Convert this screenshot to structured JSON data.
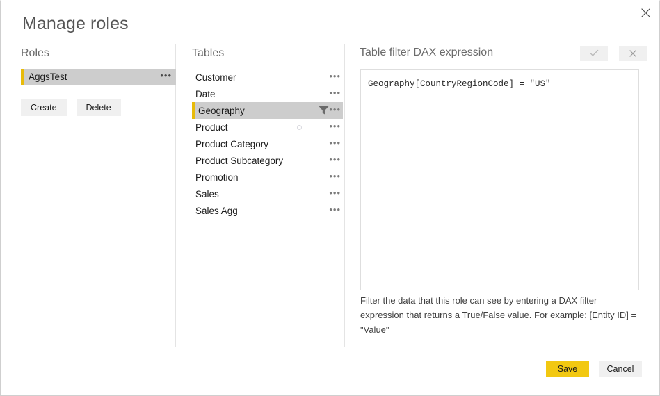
{
  "dialog": {
    "title": "Manage roles",
    "close_icon": "close-icon"
  },
  "roles_panel": {
    "header": "Roles",
    "items": [
      {
        "label": "AggsTest",
        "selected": true,
        "menu_glyph": "•••"
      }
    ],
    "create_label": "Create",
    "delete_label": "Delete"
  },
  "tables_panel": {
    "header": "Tables",
    "menu_glyph": "•••",
    "items": [
      {
        "label": "Customer",
        "selected": false,
        "has_filter": false
      },
      {
        "label": "Date",
        "selected": false,
        "has_filter": false
      },
      {
        "label": "Geography",
        "selected": true,
        "has_filter": true
      },
      {
        "label": "Product",
        "selected": false,
        "has_filter": false
      },
      {
        "label": "Product Category",
        "selected": false,
        "has_filter": false
      },
      {
        "label": "Product Subcategory",
        "selected": false,
        "has_filter": false
      },
      {
        "label": "Promotion",
        "selected": false,
        "has_filter": false
      },
      {
        "label": "Sales",
        "selected": false,
        "has_filter": false
      },
      {
        "label": "Sales Agg",
        "selected": false,
        "has_filter": false
      }
    ]
  },
  "dax_panel": {
    "header": "Table filter DAX expression",
    "accept_icon": "checkmark-icon",
    "reject_icon": "close-icon",
    "expression": "Geography[CountryRegionCode] = \"US\"",
    "help_text": "Filter the data that this role can see by entering a DAX filter expression that returns a True/False value. For example: [Entity ID] = \"Value\""
  },
  "footer": {
    "save_label": "Save",
    "cancel_label": "Cancel"
  },
  "colors": {
    "accent_gold": "#E8BB0A",
    "save_yellow": "#F2C811",
    "selection_gray": "#CDCDCD",
    "button_gray": "#F0F0F0"
  }
}
